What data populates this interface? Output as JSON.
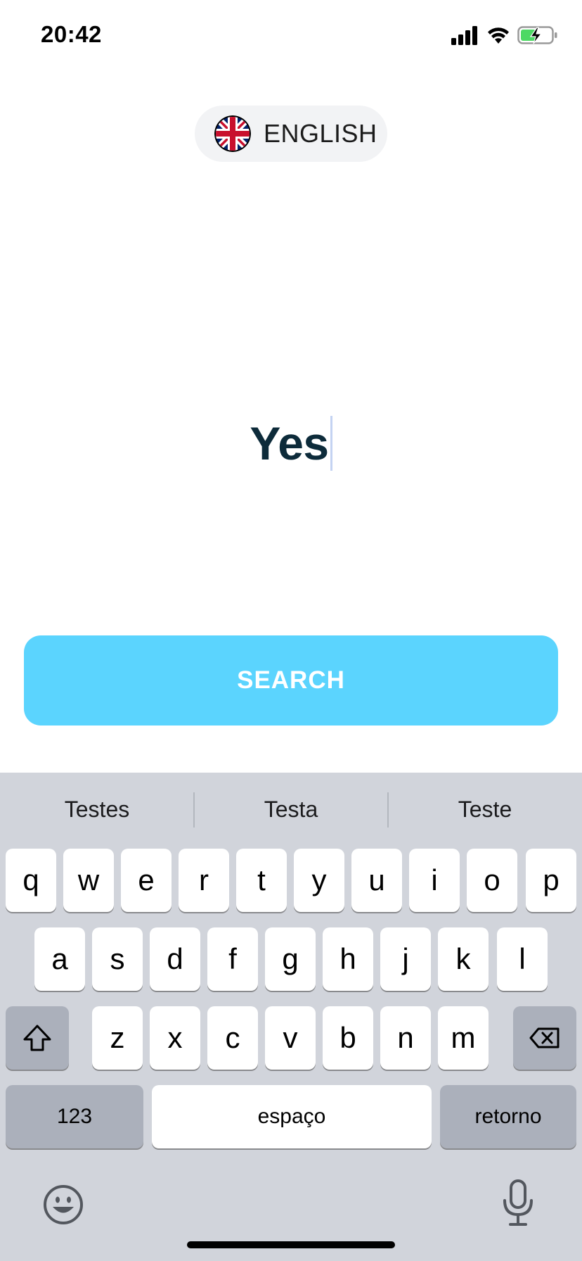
{
  "status_bar": {
    "time": "20:42",
    "icons": [
      "signal-icon",
      "wifi-icon",
      "battery-charging-icon"
    ],
    "battery_color": "#4cd964"
  },
  "language": {
    "label": "ENGLISH",
    "flag": "uk-flag-icon"
  },
  "word_input": {
    "value": "Yes"
  },
  "search_button": {
    "label": "SEARCH",
    "color": "#5bd4fe"
  },
  "keyboard": {
    "suggestions": [
      "Testes",
      "Testa",
      "Teste"
    ],
    "row1": [
      "q",
      "w",
      "e",
      "r",
      "t",
      "y",
      "u",
      "i",
      "o",
      "p"
    ],
    "row2": [
      "a",
      "s",
      "d",
      "f",
      "g",
      "h",
      "j",
      "k",
      "l"
    ],
    "row3": [
      "z",
      "x",
      "c",
      "v",
      "b",
      "n",
      "m"
    ],
    "numbers_key": "123",
    "space_key": "espaço",
    "return_key": "retorno",
    "icons": [
      "shift-icon",
      "backspace-icon",
      "emoji-icon",
      "microphone-icon"
    ]
  }
}
